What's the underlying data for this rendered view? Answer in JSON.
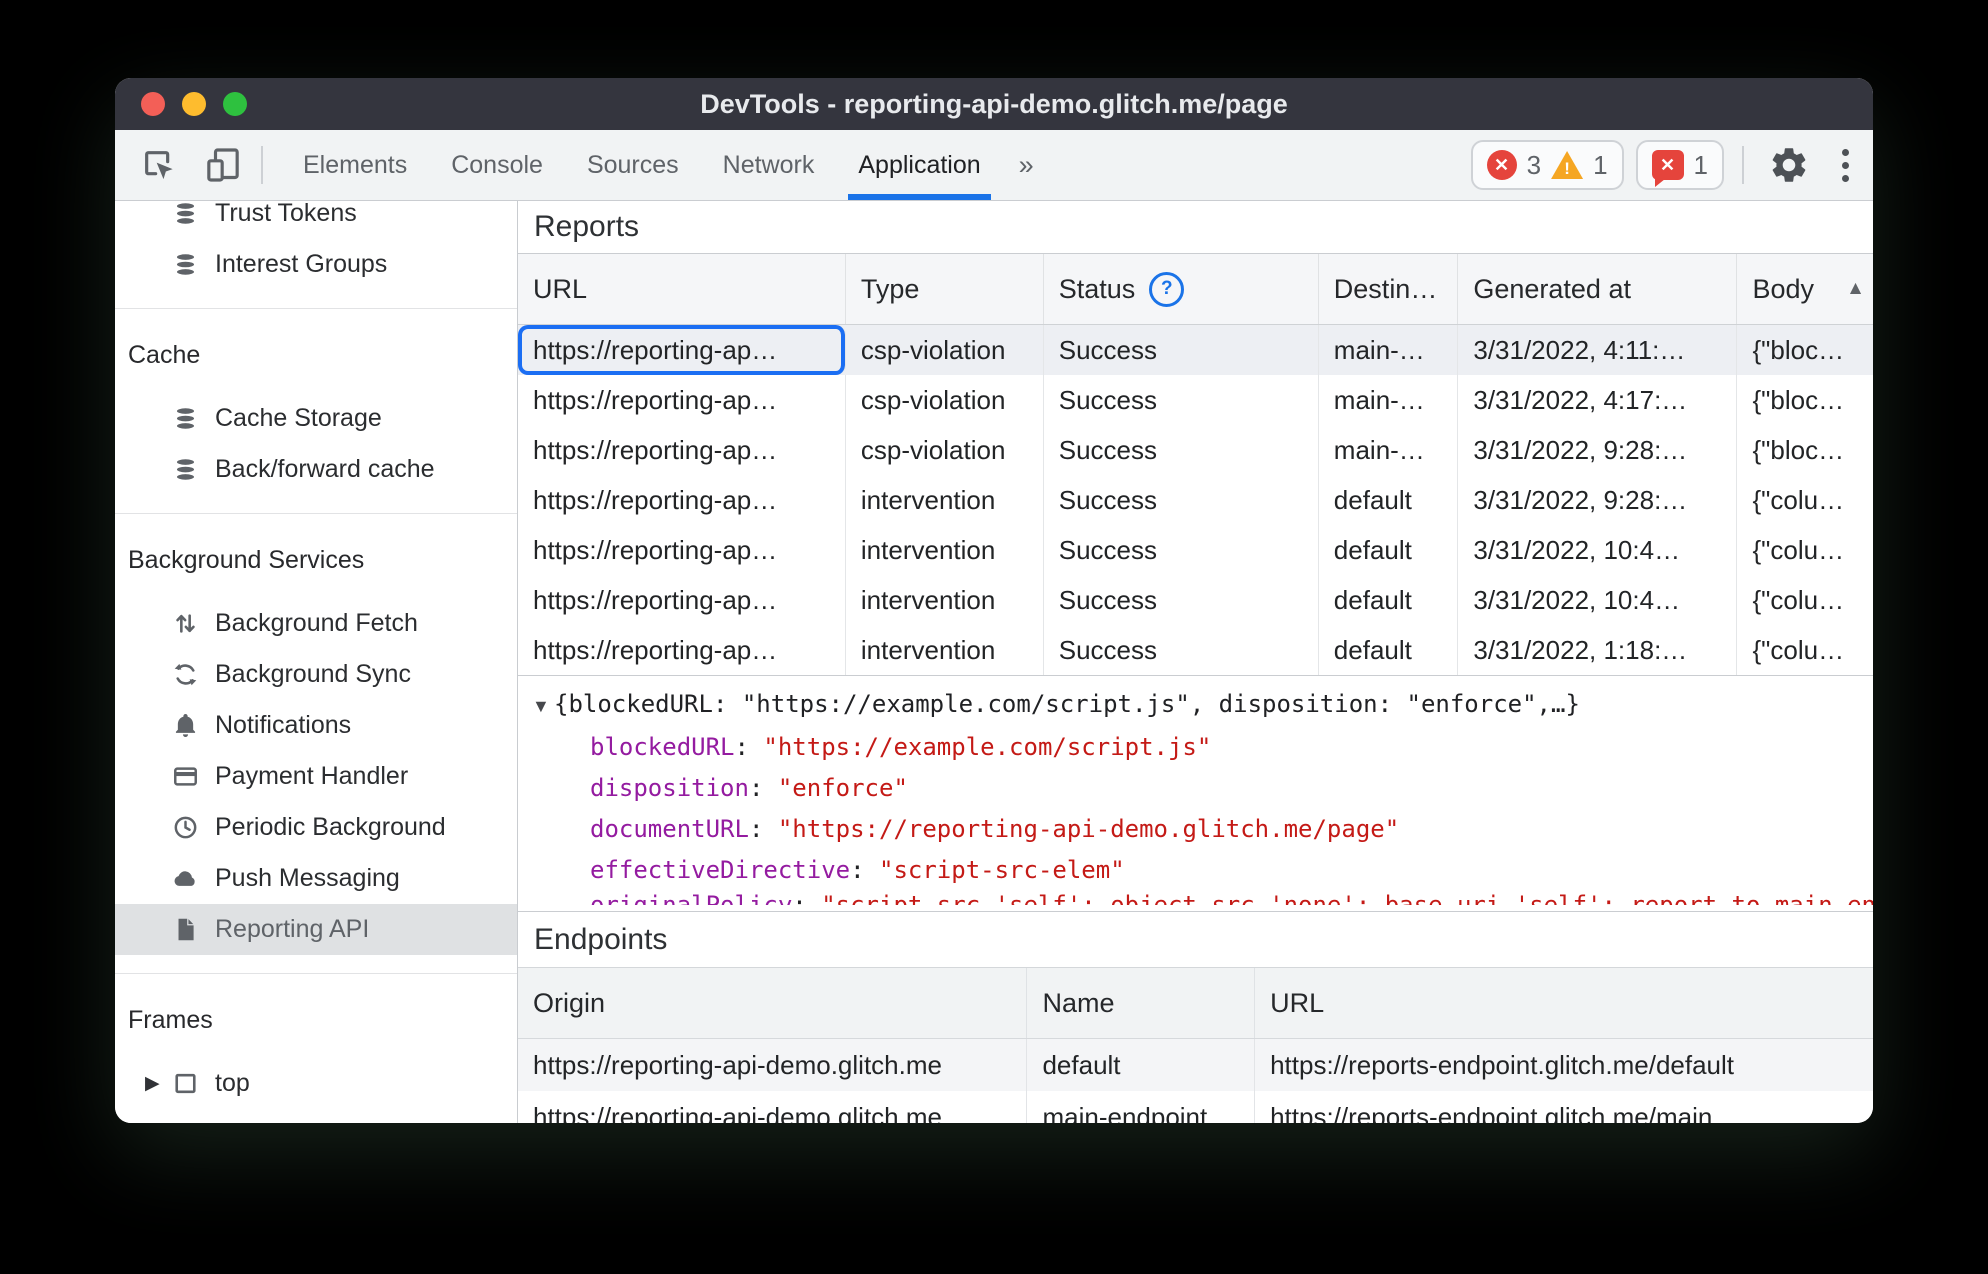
{
  "window": {
    "title": "DevTools - reporting-api-demo.glitch.me/page"
  },
  "toolbar": {
    "tabs": [
      {
        "label": "Elements"
      },
      {
        "label": "Console"
      },
      {
        "label": "Sources"
      },
      {
        "label": "Network"
      },
      {
        "label": "Application",
        "active": true
      }
    ],
    "more_tabs_label": "»",
    "badges": {
      "errors": "3",
      "warnings": "1",
      "issues": "1"
    }
  },
  "sidebar": {
    "sections": [
      {
        "items": [
          {
            "icon": "database",
            "label": "Trust Tokens"
          },
          {
            "icon": "database",
            "label": "Interest Groups"
          }
        ]
      },
      {
        "header": "Cache",
        "items": [
          {
            "icon": "database",
            "label": "Cache Storage"
          },
          {
            "icon": "database",
            "label": "Back/forward cache"
          }
        ]
      },
      {
        "header": "Background Services",
        "items": [
          {
            "icon": "fetch",
            "label": "Background Fetch"
          },
          {
            "icon": "sync",
            "label": "Background Sync"
          },
          {
            "icon": "bell",
            "label": "Notifications"
          },
          {
            "icon": "card",
            "label": "Payment Handler"
          },
          {
            "icon": "clock",
            "label": "Periodic Background"
          },
          {
            "icon": "cloud",
            "label": "Push Messaging"
          },
          {
            "icon": "doc",
            "label": "Reporting API",
            "selected": true
          }
        ]
      },
      {
        "header": "Frames",
        "items": [
          {
            "icon": "frame",
            "label": "top",
            "disclosure": true
          }
        ]
      }
    ]
  },
  "reports": {
    "title": "Reports",
    "columns": [
      {
        "key": "url",
        "label": "URL"
      },
      {
        "key": "type",
        "label": "Type"
      },
      {
        "key": "status",
        "label": "Status",
        "help": true
      },
      {
        "key": "destination",
        "label": "Destin…"
      },
      {
        "key": "generated_at",
        "label": "Generated at"
      },
      {
        "key": "body",
        "label": "Body",
        "sort": "asc"
      }
    ],
    "rows": [
      {
        "selected": true,
        "cells": [
          "https://reporting-ap…",
          "csp-violation",
          "Success",
          "main-…",
          "3/31/2022, 4:11:…",
          "{\"bloc…"
        ]
      },
      {
        "cells": [
          "https://reporting-ap…",
          "csp-violation",
          "Success",
          "main-…",
          "3/31/2022, 4:17:…",
          "{\"bloc…"
        ]
      },
      {
        "cells": [
          "https://reporting-ap…",
          "csp-violation",
          "Success",
          "main-…",
          "3/31/2022, 9:28:…",
          "{\"bloc…"
        ]
      },
      {
        "cells": [
          "https://reporting-ap…",
          "intervention",
          "Success",
          "default",
          "3/31/2022, 9:28:…",
          "{\"colu…"
        ]
      },
      {
        "cells": [
          "https://reporting-ap…",
          "intervention",
          "Success",
          "default",
          "3/31/2022, 10:4…",
          "{\"colu…"
        ]
      },
      {
        "cells": [
          "https://reporting-ap…",
          "intervention",
          "Success",
          "default",
          "3/31/2022, 10:4…",
          "{\"colu…"
        ]
      },
      {
        "cells": [
          "https://reporting-ap…",
          "intervention",
          "Success",
          "default",
          "3/31/2022, 1:18:…",
          "{\"colu…"
        ]
      }
    ]
  },
  "report_detail": {
    "preview": "{blockedURL: \"https://example.com/script.js\", disposition: \"enforce\",…}",
    "entries": [
      {
        "key": "blockedURL",
        "value": "\"https://example.com/script.js\""
      },
      {
        "key": "disposition",
        "value": "\"enforce\""
      },
      {
        "key": "documentURL",
        "value": "\"https://reporting-api-demo.glitch.me/page\""
      },
      {
        "key": "effectiveDirective",
        "value": "\"script-src-elem\""
      }
    ],
    "clipped_entry": {
      "key": "originalPolicy",
      "value": "\"script-src 'self'; object-src 'none'; base-uri 'self'; report-to main-endpoint\""
    }
  },
  "endpoints": {
    "title": "Endpoints",
    "columns": [
      {
        "key": "origin",
        "label": "Origin"
      },
      {
        "key": "name",
        "label": "Name"
      },
      {
        "key": "url",
        "label": "URL"
      }
    ],
    "rows": [
      [
        "https://reporting-api-demo.glitch.me",
        "default",
        "https://reports-endpoint.glitch.me/default"
      ],
      [
        "https://reporting-api-demo.glitch.me",
        "main-endpoint",
        "https://reports-endpoint.glitch.me/main"
      ]
    ]
  },
  "colors": {
    "accent": "#1a73e8",
    "error": "#e5443c",
    "warning": "#f5a623",
    "json_key": "#941ba0",
    "json_string": "#c41a16",
    "titlebar_bg": "#34353e",
    "toolbar_bg": "#f1f3f4",
    "selected_row_bg": "#edeff3"
  }
}
